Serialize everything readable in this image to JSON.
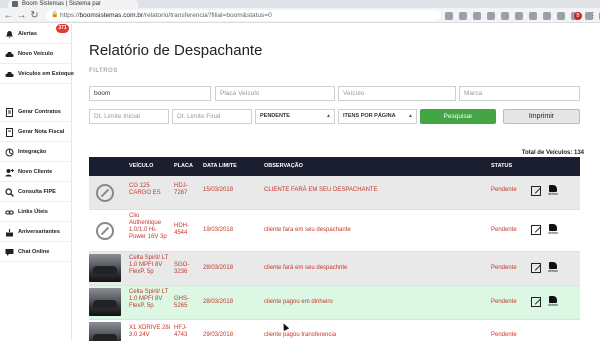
{
  "browser": {
    "tab_title": "Boom Sistemas | Sistema par",
    "url_scheme": "https://",
    "url_host": "boomsistemas.com.br",
    "url_path": "/relatorio/transferencia?filial=boom&status=0",
    "avatar_letter": "B"
  },
  "sidebar": {
    "alert_badge": "371",
    "items": [
      {
        "label": "Alertas",
        "icon": "bell-icon"
      },
      {
        "label": "Novo Veículo",
        "icon": "car-plus-icon"
      },
      {
        "label": "Veículos em Estoque",
        "icon": "car-stock-icon"
      },
      {
        "label": "Gerar Contratos",
        "icon": "contract-icon"
      },
      {
        "label": "Gerar Nota Fiscal",
        "icon": "invoice-icon"
      },
      {
        "label": "Integração",
        "icon": "integration-icon"
      },
      {
        "label": "Novo Cliente",
        "icon": "user-plus-icon"
      },
      {
        "label": "Consulta FIPE",
        "icon": "search-icon"
      },
      {
        "label": "Links Úteis",
        "icon": "link-icon"
      },
      {
        "label": "Aniversariantes",
        "icon": "cake-icon"
      },
      {
        "label": "Chat Online",
        "icon": "chat-icon"
      }
    ]
  },
  "main": {
    "title": "Relatório de Despachante",
    "filters_label": "FILTROS",
    "filters": {
      "search_value": "boom",
      "plate_placeholder": "Placa Veículo",
      "vehicle_placeholder": "Veículo",
      "brand_placeholder": "Marca",
      "date_start_placeholder": "Dt. Limite Inicial",
      "date_end_placeholder": "Dt. Limite Final",
      "status_selected": "PENDENTE",
      "per_page_selected": "ITENS POR PÁGINA"
    },
    "search_button": "Pesquisar",
    "print_button": "Imprimir",
    "total_text": "Total de Veículos: 134",
    "columns": [
      "VEÍCULO",
      "PLACA",
      "DATA LIMITE",
      "OBSERVAÇÃO",
      "STATUS"
    ],
    "rows": [
      {
        "photo": "none",
        "vehicle": "CG 125 CARGO ES",
        "plate": "HDJ-7287",
        "date": "15/03/2018",
        "observation": "CLIENTE FARÁ EM SEU DESPACHANTE",
        "status": "Pendente"
      },
      {
        "photo": "none",
        "vehicle": "Clio Authentique 1.0/1.0 Hi-Power 16V 3p",
        "plate": "HDH-4544",
        "date": "19/03/2018",
        "observation": "cliente fara em seu despachante",
        "status": "Pendente"
      },
      {
        "photo": "car",
        "vehicle": "Celta Spirit/ LT 1.0 MPFI 8V FlexP. 5p",
        "plate": "SGO-3236",
        "date": "28/03/2018",
        "observation": "cliente fará em seu despachnte",
        "status": "Pendente"
      },
      {
        "photo": "car",
        "vehicle": "Celta Spirit/ LT 1.0 MPFI 8V FlexP. 5p",
        "plate": "GHS-5265",
        "date": "28/03/2018",
        "observation": "cliente pagou em dinheiro",
        "status": "Pendente"
      },
      {
        "photo": "car",
        "vehicle": "X1 XDRIVE 28i 3.0 24V",
        "plate": "HFJ-4743",
        "date": "29/03/2018",
        "observation": "cliente pagou transferencia",
        "status": "Pendente"
      }
    ],
    "detran_label": "detran"
  },
  "colors": {
    "header_dark": "#1b1e2f",
    "accent_green": "#43a543",
    "text_red": "#c0392b",
    "row_highlight": "#dcf8e4"
  }
}
